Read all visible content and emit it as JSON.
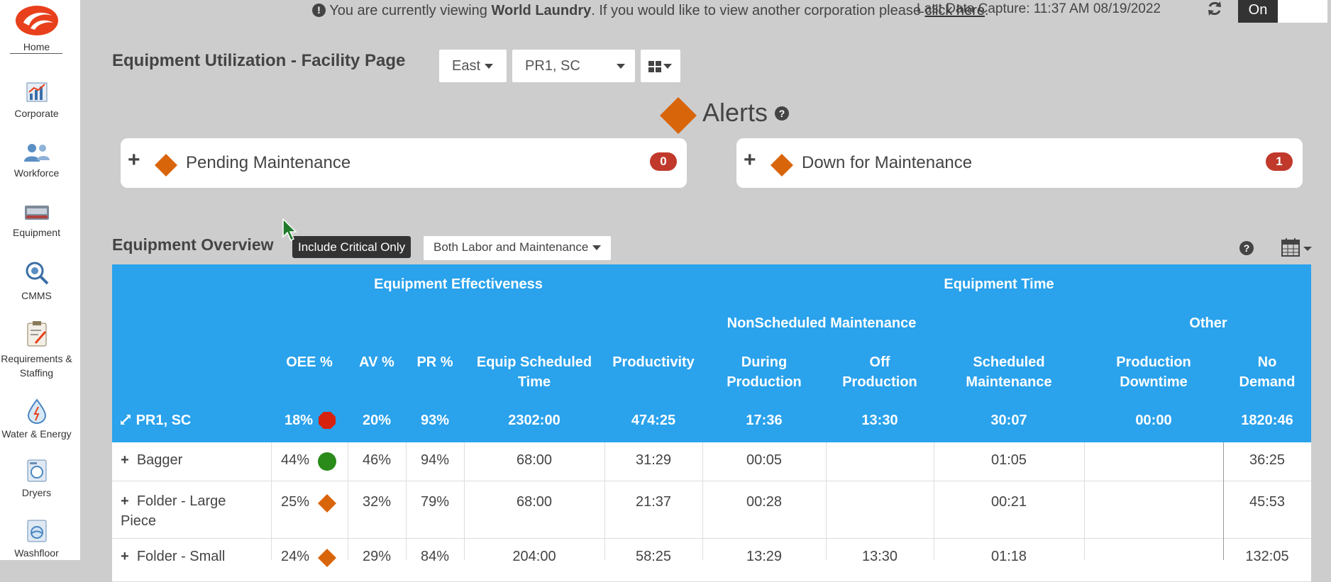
{
  "sidebar": {
    "items": [
      {
        "label": "Home",
        "icon": "home-logo-icon"
      },
      {
        "label": "Corporate",
        "icon": "chart-icon"
      },
      {
        "label": "Workforce",
        "icon": "people-icon"
      },
      {
        "label": "Equipment",
        "icon": "machine-icon"
      },
      {
        "label": "CMMS",
        "icon": "gear-search-icon"
      },
      {
        "label": "Requirements &",
        "label2": "Staffing",
        "icon": "clipboard-icon"
      },
      {
        "label": "Water & Energy",
        "icon": "water-drop-icon"
      },
      {
        "label": "Dryers",
        "icon": "dryer-icon"
      },
      {
        "label": "Washfloor",
        "icon": "washer-icon"
      }
    ]
  },
  "notice": {
    "prefix": "You are currently viewing ",
    "corporation": "World Laundry",
    "middle": ". If you would like to view another corporation please ",
    "link": "click here",
    "suffix": "."
  },
  "capture": {
    "text": "Last Data Capture: 11:37 AM 08/19/2022"
  },
  "toggle": {
    "label": "On"
  },
  "page_title": "Equipment Utilization - Facility Page",
  "region_select": {
    "value": "East"
  },
  "facility_select": {
    "value": "PR1, SC"
  },
  "alerts": {
    "title": "Alerts",
    "help": "?",
    "cards": [
      {
        "plus": "+",
        "label": "Pending Maintenance",
        "count": "0"
      },
      {
        "plus": "+",
        "label": "Down for Maintenance",
        "count": "1"
      }
    ]
  },
  "overview": {
    "title": "Equipment Overview",
    "critical_btn": "Include Critical Only",
    "labor_select": "Both Labor and Maintenance",
    "help": "?"
  },
  "table": {
    "group_headers": {
      "effectiveness": "Equipment Effectiveness",
      "time": "Equipment Time"
    },
    "sub_headers": {
      "nonscheduled": "NonScheduled Maintenance",
      "other": "Other"
    },
    "columns": [
      {
        "l1": "OEE %",
        "l2": ""
      },
      {
        "l1": "AV %",
        "l2": ""
      },
      {
        "l1": "PR %",
        "l2": ""
      },
      {
        "l1": "Equip Scheduled",
        "l2": "Time"
      },
      {
        "l1": "Productivity",
        "l2": ""
      },
      {
        "l1": "During",
        "l2": "Production"
      },
      {
        "l1": "Off",
        "l2": "Production"
      },
      {
        "l1": "Scheduled",
        "l2": "Maintenance"
      },
      {
        "l1": "Production",
        "l2": "Downtime"
      },
      {
        "l1": "No",
        "l2": "Demand"
      }
    ],
    "total": {
      "name": "PR1, SC",
      "oee": "18%",
      "status": "red-octagon",
      "av": "20%",
      "pr": "93%",
      "sched": "2302:00",
      "prod": "474:25",
      "during": "17:36",
      "off": "13:30",
      "smaint": "30:07",
      "pdown": "00:00",
      "nodemand": "1820:46"
    },
    "rows": [
      {
        "plus": "+",
        "name": "Bagger",
        "name2": "",
        "oee": "44%",
        "status": "green-circle",
        "av": "46%",
        "pr": "94%",
        "sched": "68:00",
        "prod": "31:29",
        "during": "00:05",
        "off": "",
        "smaint": "01:05",
        "pdown": "",
        "nodemand": "36:25"
      },
      {
        "plus": "+",
        "name": "Folder - Large",
        "name2": "Piece",
        "oee": "25%",
        "status": "orange-diamond",
        "av": "32%",
        "pr": "79%",
        "sched": "68:00",
        "prod": "21:37",
        "during": "00:28",
        "off": "",
        "smaint": "00:21",
        "pdown": "",
        "nodemand": "45:53"
      },
      {
        "plus": "+",
        "name": "Folder - Small",
        "name2": "",
        "oee": "24%",
        "status": "orange-diamond",
        "av": "29%",
        "pr": "84%",
        "sched": "204:00",
        "prod": "58:25",
        "during": "13:29",
        "off": "13:30",
        "smaint": "01:18",
        "pdown": "",
        "nodemand": "132:05"
      }
    ]
  }
}
